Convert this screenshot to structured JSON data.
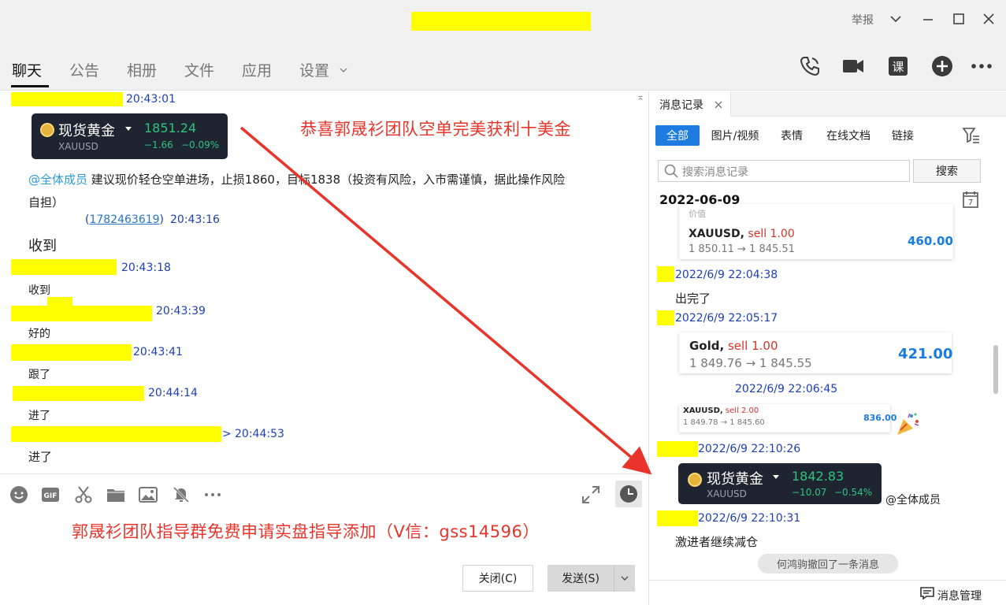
{
  "window": {
    "report_label": "举报",
    "controls": [
      "chevron-down-icon",
      "minimize-icon",
      "maximize-icon",
      "close-icon"
    ]
  },
  "tabs": [
    {
      "label": "聊天",
      "active": true
    },
    {
      "label": "公告"
    },
    {
      "label": "相册"
    },
    {
      "label": "文件"
    },
    {
      "label": "应用"
    },
    {
      "label": "设置"
    }
  ],
  "toolbar_icons": [
    "phone-icon",
    "video-call-icon",
    "lesson-icon",
    "add-icon",
    "more-icon"
  ],
  "chat": {
    "messages": [
      {
        "time": "20:43:01"
      },
      {
        "card": {
          "name": "现货黄金",
          "symbol": "XAUUSD",
          "price": "1851.24",
          "change": "−1.66",
          "change_pct": "−0.09%"
        }
      },
      {
        "mention": "@全体成员",
        "text_line1": " 建议现价轻仓空单进场，止损1860，目标1838（投资有风险，入市需谨慎，据此操作风险",
        "text_line2": "自担）"
      },
      {
        "id_open": "(",
        "id_link": "1782463619",
        "id_close": ")",
        "time": "20:43:16"
      },
      {
        "text": "收到"
      },
      {
        "time": "20:43:18"
      },
      {
        "text": "收到"
      },
      {
        "time": "20:43:39"
      },
      {
        "text": "好的"
      },
      {
        "time": "20:43:41"
      },
      {
        "text": "跟了"
      },
      {
        "time": "20:44:14"
      },
      {
        "text": "进了"
      },
      {
        "prefix": ">",
        "time": "20:44:53"
      },
      {
        "text": "进了"
      }
    ],
    "annotation_top": "恭喜郭晟衫团队空单完美获利十美金"
  },
  "input": {
    "icons": [
      "emoji-icon",
      "gif-icon",
      "scissors-icon",
      "folder-icon",
      "image-icon",
      "bell-off-icon",
      "more-dots-icon"
    ],
    "right_icons": [
      "expand-icon",
      "history-clock-icon"
    ],
    "annotation_bottom": "郭晟衫团队指导群免费申请实盘指导添加（V信：gss14596）",
    "close_button": "关闭(C)",
    "send_button": "发送(S)"
  },
  "history": {
    "tab_label": "消息记录",
    "filters": [
      "全部",
      "图片/视频",
      "表情",
      "在线文档",
      "链接"
    ],
    "search_placeholder": "搜索消息记录",
    "search_button": "搜索",
    "date": "2022-06-09",
    "cut_text": "价值",
    "entries": [
      {
        "card": {
          "symbol": "XAUUSD,",
          "side": " sell 1.00",
          "path": "1 850.11 → 1 845.51",
          "amount": "460.00"
        }
      },
      {
        "time": "2022/6/9 22:04:38",
        "text": "出完了"
      },
      {
        "time": "2022/6/9 22:05:17"
      },
      {
        "card": {
          "symbol": "Gold,",
          "side": " sell 1.00",
          "path": "1 849.76 → 1 845.55",
          "amount": "421.00"
        }
      },
      {
        "time": "2022/6/9 22:06:45"
      },
      {
        "card": {
          "symbol": "XAUUSD,",
          "side": " sell 2.00",
          "path": "1 849.78 → 1 845.60",
          "amount": "836.00"
        }
      },
      {
        "time": "2022/6/9 22:10:26"
      },
      {
        "gold": {
          "name": "现货黄金",
          "symbol": "XAUUSD",
          "price": "1842.83",
          "change": "−10.07",
          "change_pct": "−0.54%"
        },
        "mention": "@全体成员"
      },
      {
        "time": "2022/6/9 22:10:31",
        "text": "激进者继续减仓"
      }
    ],
    "recall_notice": "何鸿驹撤回了一条消息",
    "manage_label": "消息管理"
  },
  "colors": {
    "accent_blue": "#1e7be0",
    "annotation_red": "#e8342a",
    "redaction": "#ffff00",
    "gold_green": "#2ec27e"
  }
}
